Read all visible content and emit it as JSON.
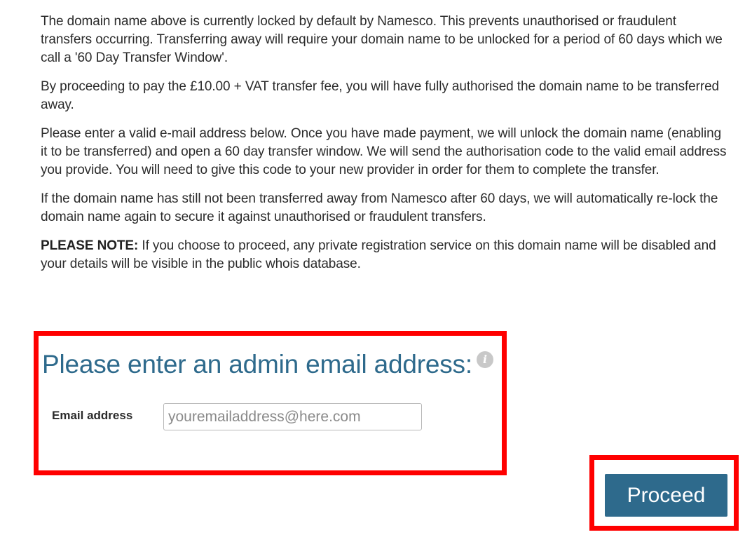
{
  "info": {
    "paragraph_1": "The domain name above is currently locked by default by Namesco. This prevents unauthorised or fraudulent transfers occurring. Transferring away will require your domain name to be unlocked for a period of 60 days which we call a '60 Day Transfer Window'.",
    "paragraph_2": "By proceeding to pay the £10.00 + VAT transfer fee, you will have fully authorised the domain name to be transferred away.",
    "paragraph_3": "Please enter a valid e-mail address below. Once you have made payment, we will unlock the domain name (enabling it to be transferred) and open a 60 day transfer window. We will send the authorisation code to the valid email address you provide. You will need to give this code to your new provider in order for them to complete the transfer.",
    "paragraph_4": "If the domain name has still not been transferred away from Namesco after 60 days, we will automatically re-lock the domain name again to secure it against unauthorised or fraudulent transfers.",
    "note_label": "PLEASE NOTE:",
    "note_text": " If you choose to proceed, any private registration service on this domain name will be disabled and your details will be visible in the public whois database."
  },
  "admin_form": {
    "title": "Please enter an admin email address:",
    "info_icon_glyph": "i",
    "email_label": "Email address",
    "email_value": "",
    "email_placeholder": "youremailaddress@here.com"
  },
  "actions": {
    "proceed_label": "Proceed"
  },
  "colors": {
    "accent": "#2e6a8c",
    "highlight_border": "#ff0000",
    "info_icon": "#c8c8c8"
  }
}
